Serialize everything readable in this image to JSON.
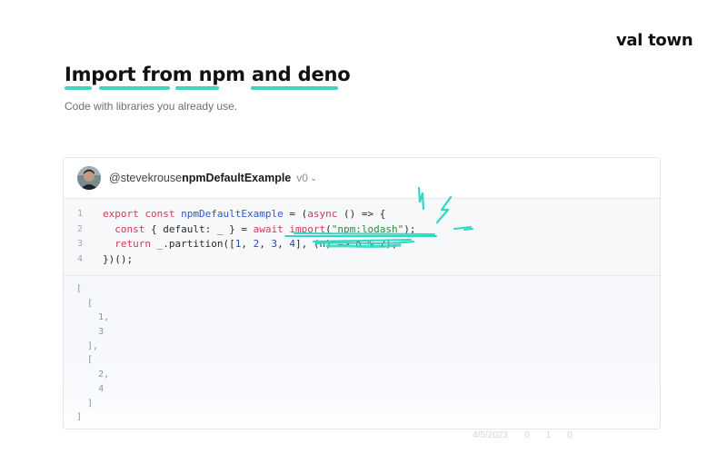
{
  "brand": {
    "name": "val town"
  },
  "hero": {
    "title": "Import from npm and deno",
    "subtitle": "Code with libraries you already use."
  },
  "val": {
    "user": "@stevekrouse",
    "name": "npmDefaultExample",
    "version": "v0"
  },
  "code": {
    "line_numbers": [
      "1",
      "2",
      "3",
      "4"
    ],
    "line1": {
      "kw1": "export",
      "kw2": "const",
      "name": "npmDefaultExample",
      "eq": " = (",
      "async": "async",
      "rest": " () => {"
    },
    "line2": {
      "kw": "const",
      "destructure": " { default: _ } = ",
      "await": "await",
      "space": " ",
      "import": "import",
      "paren_open": "(",
      "str": "\"npm:lodash\"",
      "paren_close": ");"
    },
    "line3": {
      "kw": "return",
      "call": " _.partition([",
      "n1": "1",
      "c1": ", ",
      "n2": "2",
      "c2": ", ",
      "n3": "3",
      "c3": ", ",
      "n4": "4",
      "rest": "], (n) => n % 2);"
    },
    "line4": {
      "text": "})();"
    }
  },
  "output": {
    "lines": [
      "[",
      "  [",
      "    1,",
      "    3",
      "  ],",
      "  [",
      "    2,",
      "    4",
      "  ]",
      "]"
    ]
  },
  "footer": {
    "items": [
      "4/5/2023",
      "0",
      "1",
      "0"
    ]
  },
  "colors": {
    "accent": "#3fd6c1",
    "keyword": "#cf3b5a",
    "function": "#3355cc",
    "string": "#2c8a3a"
  }
}
